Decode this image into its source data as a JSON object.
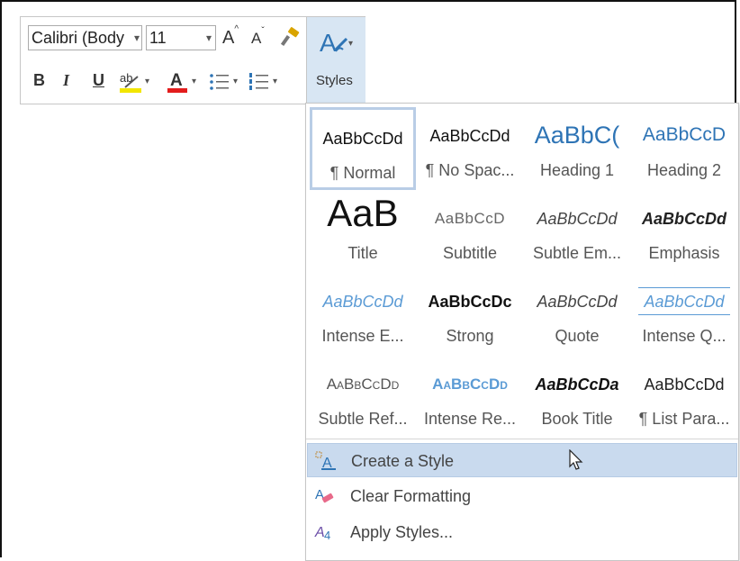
{
  "toolbar": {
    "font_name": "Calibri (Body",
    "font_size": "11",
    "grow_glyph": "A",
    "shrink_glyph": "A",
    "bold": "B",
    "italic": "I",
    "underline": "U",
    "highlight_glyph": "ab",
    "fontcolor_glyph": "A",
    "highlight_color": "#f2e600",
    "fontcolor_color": "#e31c1c",
    "styles_label": "Styles"
  },
  "gallery": {
    "styles": [
      {
        "preview": "AaBbCcDd",
        "label": "¶ Normal",
        "selected": true
      },
      {
        "preview": "AaBbCcDd",
        "label": "¶ No Spac..."
      },
      {
        "preview": "AaBbC(",
        "label": "Heading 1"
      },
      {
        "preview": "AaBbCcD",
        "label": "Heading 2"
      },
      {
        "preview": "AaB",
        "label": "Title"
      },
      {
        "preview": "AaBbCcD",
        "label": "Subtitle"
      },
      {
        "preview": "AaBbCcDd",
        "label": "Subtle Em..."
      },
      {
        "preview": "AaBbCcDd",
        "label": "Emphasis"
      },
      {
        "preview": "AaBbCcDd",
        "label": "Intense E..."
      },
      {
        "preview": "AaBbCcDc",
        "label": "Strong"
      },
      {
        "preview": "AaBbCcDd",
        "label": "Quote"
      },
      {
        "preview": "AaBbCcDd",
        "label": "Intense Q..."
      },
      {
        "preview": "AaBbCcDd",
        "label": "Subtle Ref..."
      },
      {
        "preview": "AaBbCcDd",
        "label": "Intense Re..."
      },
      {
        "preview": "AaBbCcDa",
        "label": "Book Title"
      },
      {
        "preview": "AaBbCcDd",
        "label": "¶ List Para..."
      }
    ],
    "menu": [
      {
        "label": "Create a Style",
        "icon": "create-style-icon",
        "highlighted": true
      },
      {
        "label": "Clear Formatting",
        "icon": "clear-formatting-icon"
      },
      {
        "label": "Apply Styles...",
        "icon": "apply-styles-icon"
      }
    ],
    "colors": {
      "heading_blue": "#2e74b5",
      "intense_blue": "#5b9bd5",
      "hover_bg": "#c9daee",
      "selected_border": "#b9cde6"
    }
  }
}
